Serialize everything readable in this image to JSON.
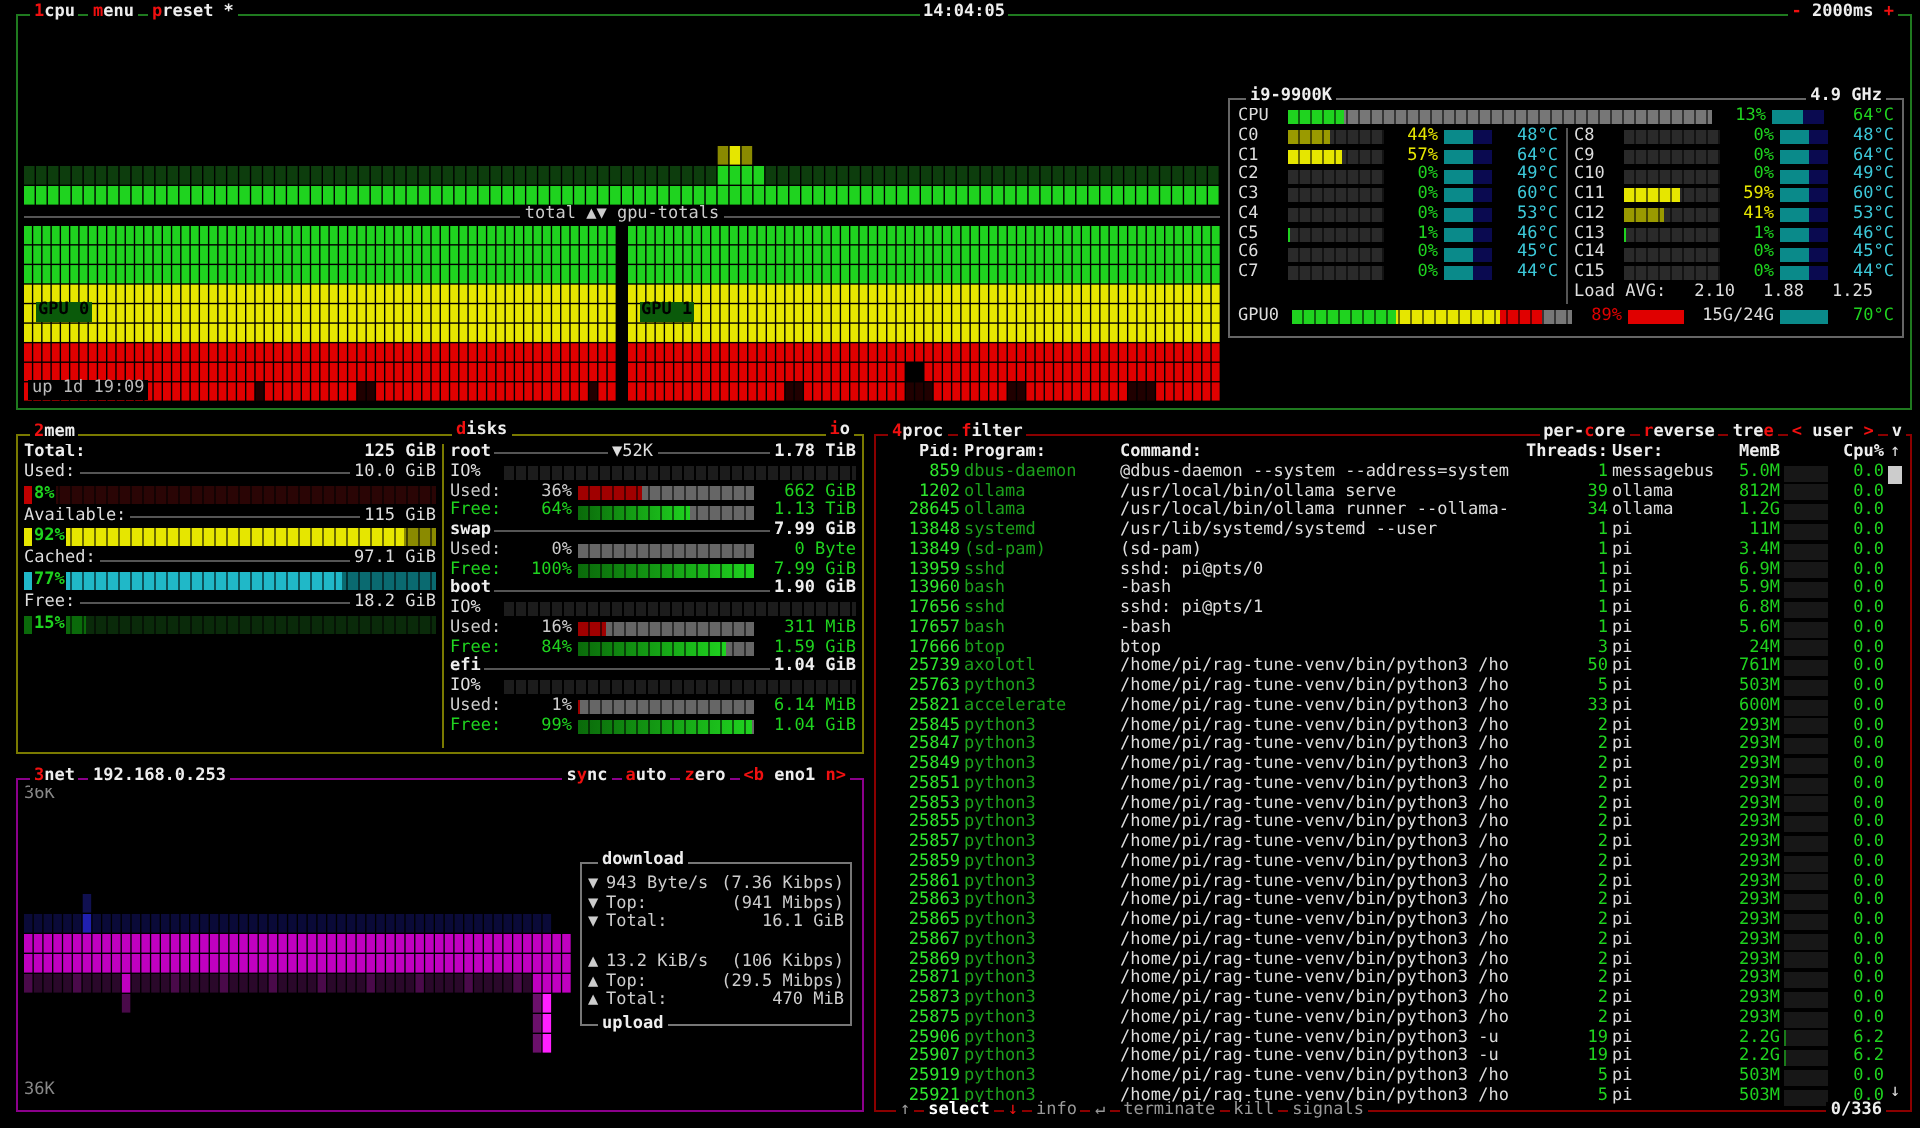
{
  "cpu": {
    "title_items": [
      {
        "key": "1",
        "post": "cpu"
      },
      {
        "key": "m",
        "post": "enu"
      },
      {
        "key": "p",
        "post": "reset *"
      }
    ],
    "clock": "14:04:05",
    "interval": {
      "minus": "-",
      "value": "2000ms",
      "plus": "+"
    },
    "graph_label": "total ▲▼ gpu-totals",
    "gpus": [
      {
        "label": "GPU 0"
      },
      {
        "label": "GPU 1"
      }
    ],
    "uptime": "up 1d 19:09",
    "info": {
      "model": "i9-9900K",
      "freq": "4.9 GHz",
      "total": {
        "label": "CPU",
        "level": 0.13,
        "percent": "13%",
        "temp": "64°C"
      },
      "cores": [
        {
          "name": "C0",
          "level": 0.44,
          "percent": "44%",
          "temp": "48°C"
        },
        {
          "name": "C1",
          "level": 0.57,
          "percent": "57%",
          "temp": "64°C"
        },
        {
          "name": "C2",
          "level": 0,
          "percent": "0%",
          "temp": "49°C"
        },
        {
          "name": "C3",
          "level": 0,
          "percent": "0%",
          "temp": "60°C"
        },
        {
          "name": "C4",
          "level": 0,
          "percent": "0%",
          "temp": "53°C"
        },
        {
          "name": "C5",
          "level": 0.01,
          "percent": "1%",
          "temp": "46°C"
        },
        {
          "name": "C6",
          "level": 0,
          "percent": "0%",
          "temp": "45°C"
        },
        {
          "name": "C7",
          "level": 0,
          "percent": "0%",
          "temp": "44°C"
        },
        {
          "name": "C8",
          "level": 0,
          "percent": "0%",
          "temp": "48°C"
        },
        {
          "name": "C9",
          "level": 0,
          "percent": "0%",
          "temp": "64°C"
        },
        {
          "name": "C10",
          "level": 0,
          "percent": "0%",
          "temp": "49°C"
        },
        {
          "name": "C11",
          "level": 0.59,
          "percent": "59%",
          "temp": "60°C"
        },
        {
          "name": "C12",
          "level": 0.41,
          "percent": "41%",
          "temp": "53°C"
        },
        {
          "name": "C13",
          "level": 0.01,
          "percent": "1%",
          "temp": "46°C"
        },
        {
          "name": "C14",
          "level": 0,
          "percent": "0%",
          "temp": "45°C"
        },
        {
          "name": "C15",
          "level": 0,
          "percent": "0%",
          "temp": "44°C"
        }
      ],
      "load_label": "Load AVG:",
      "load": [
        "2.10",
        "1.88",
        "1.25"
      ],
      "gpu": {
        "label": "GPU0",
        "level": 0.89,
        "percent": "89%",
        "mem": "15G/24G",
        "temp": "70°C"
      }
    }
  },
  "mem": {
    "title": {
      "key": "2",
      "post": "mem"
    },
    "total": {
      "label": "Total:",
      "value": "125 GiB"
    },
    "meters": [
      {
        "kind": "used",
        "label": "Used:",
        "value": "10.0 GiB",
        "percent": "8%",
        "level": 0.08
      },
      {
        "kind": "available",
        "label": "Available:",
        "value": "115 GiB",
        "percent": "92%",
        "level": 0.92
      },
      {
        "kind": "cached",
        "label": "Cached:",
        "value": "97.1 GiB",
        "percent": "77%",
        "level": 0.77
      },
      {
        "kind": "free",
        "label": "Free:",
        "value": "18.2 GiB",
        "percent": "15%",
        "level": 0.15
      }
    ]
  },
  "disks": {
    "title": {
      "key": "d",
      "post": "isks"
    },
    "io_toggle": {
      "key": "i",
      "post": "o"
    },
    "items": [
      {
        "name": "root",
        "io_rate": "▼52K",
        "total": "1.78 TiB",
        "io_label": "IO%",
        "used": {
          "label": "Used:",
          "percent": "36%",
          "level": 0.36,
          "value": "662 GiB"
        },
        "free": {
          "label": "Free:",
          "percent": "64%",
          "level": 0.64,
          "value": "1.13 TiB"
        }
      },
      {
        "name": "swap",
        "total": "7.99 GiB",
        "used": {
          "label": "Used:",
          "percent": "0%",
          "level": 0,
          "value": "0 Byte"
        },
        "free": {
          "label": "Free:",
          "percent": "100%",
          "level": 1,
          "value": "7.99 GiB"
        }
      },
      {
        "name": "boot",
        "total": "1.90 GiB",
        "io_label": "IO%",
        "used": {
          "label": "Used:",
          "percent": "16%",
          "level": 0.16,
          "value": "311 MiB"
        },
        "free": {
          "label": "Free:",
          "percent": "84%",
          "level": 0.84,
          "value": "1.59 GiB"
        }
      },
      {
        "name": "efi",
        "total": "1.04 GiB",
        "io_label": "IO%",
        "used": {
          "label": "Used:",
          "percent": "1%",
          "level": 0.01,
          "value": "6.14 MiB"
        },
        "free": {
          "label": "Free:",
          "percent": "99%",
          "level": 0.99,
          "value": "1.04 GiB"
        }
      }
    ]
  },
  "net": {
    "title": {
      "key": "3",
      "post": "net"
    },
    "address": "192.168.0.253",
    "options": [
      {
        "pre": "s",
        "key": "y",
        "post": "nc"
      },
      {
        "key": "a",
        "post": "uto"
      },
      {
        "key": "z",
        "post": "ero"
      }
    ],
    "interface": {
      "prev": "<b",
      "name": "eno1",
      "next": "n>"
    },
    "scale_top": "36K",
    "scale_bottom": "36K",
    "download": {
      "title": "download",
      "rows": [
        {
          "icon": "▼",
          "label": "943 Byte/s",
          "value": "(7.36 Kibps)"
        },
        {
          "icon": "▼",
          "label": "Top:",
          "value": "(941 Mibps)"
        },
        {
          "icon": "▼",
          "label": "Total:",
          "value": "16.1 GiB"
        }
      ]
    },
    "upload": {
      "title": "upload",
      "rows": [
        {
          "icon": "▲",
          "label": "13.2 KiB/s",
          "value": "(106 Kibps)"
        },
        {
          "icon": "▲",
          "label": "Top:",
          "value": "(29.5 Mibps)"
        },
        {
          "icon": "▲",
          "label": "Total:",
          "value": "470 MiB"
        }
      ]
    }
  },
  "proc": {
    "title": {
      "key": "4",
      "post": "proc"
    },
    "filter": {
      "key": "f",
      "post": "ilter"
    },
    "options": [
      {
        "pre": "per-",
        "key": "c",
        "post": "ore"
      },
      {
        "key": "r",
        "post": "everse"
      },
      {
        "pre": "tre",
        "key": "e"
      }
    ],
    "sort": {
      "prev": "<",
      "label": "user",
      "next": ">"
    },
    "cut_option": "v",
    "columns": [
      "Pid:",
      "Program:",
      "Command:",
      "Threads:",
      "User:",
      "MemB",
      "Cpu%"
    ],
    "scroll_up": "↑",
    "scroll_down": "↓",
    "rows": [
      {
        "pid": "859",
        "program": "dbus-daemon",
        "command": "@dbus-daemon --system --address=system",
        "threads": "1",
        "user": "messagebus",
        "mem": "5.0M",
        "level": 0,
        "cpu": "0.0"
      },
      {
        "pid": "1202",
        "program": "ollama",
        "command": "/usr/local/bin/ollama serve",
        "threads": "39",
        "user": "ollama",
        "mem": "812M",
        "level": 0,
        "cpu": "0.0"
      },
      {
        "pid": "28645",
        "program": "ollama",
        "command": "/usr/local/bin/ollama runner --ollama-",
        "threads": "34",
        "user": "ollama",
        "mem": "1.2G",
        "level": 0,
        "cpu": "0.0"
      },
      {
        "pid": "13848",
        "program": "systemd",
        "command": "/usr/lib/systemd/systemd --user",
        "threads": "1",
        "user": "pi",
        "mem": "11M",
        "level": 0,
        "cpu": "0.0"
      },
      {
        "pid": "13849",
        "program": "(sd-pam)",
        "command": "(sd-pam)",
        "threads": "1",
        "user": "pi",
        "mem": "3.4M",
        "level": 0,
        "cpu": "0.0"
      },
      {
        "pid": "13959",
        "program": "sshd",
        "command": "sshd: pi@pts/0",
        "threads": "1",
        "user": "pi",
        "mem": "6.9M",
        "level": 0,
        "cpu": "0.0"
      },
      {
        "pid": "13960",
        "program": "bash",
        "command": "-bash",
        "threads": "1",
        "user": "pi",
        "mem": "5.9M",
        "level": 0,
        "cpu": "0.0"
      },
      {
        "pid": "17656",
        "program": "sshd",
        "command": "sshd: pi@pts/1",
        "threads": "1",
        "user": "pi",
        "mem": "6.8M",
        "level": 0,
        "cpu": "0.0"
      },
      {
        "pid": "17657",
        "program": "bash",
        "command": "-bash",
        "threads": "1",
        "user": "pi",
        "mem": "5.6M",
        "level": 0,
        "cpu": "0.0"
      },
      {
        "pid": "17666",
        "program": "btop",
        "command": "btop",
        "threads": "3",
        "user": "pi",
        "mem": "24M",
        "level": 0,
        "cpu": "0.0"
      },
      {
        "pid": "25739",
        "program": "axolotl",
        "command": "/home/pi/rag-tune-venv/bin/python3 /ho",
        "threads": "50",
        "user": "pi",
        "mem": "761M",
        "level": 0,
        "cpu": "0.0"
      },
      {
        "pid": "25763",
        "program": "python3",
        "command": "/home/pi/rag-tune-venv/bin/python3 /ho",
        "threads": "5",
        "user": "pi",
        "mem": "503M",
        "level": 0,
        "cpu": "0.0"
      },
      {
        "pid": "25821",
        "program": "accelerate",
        "command": "/home/pi/rag-tune-venv/bin/python3 /ho",
        "threads": "33",
        "user": "pi",
        "mem": "600M",
        "level": 0,
        "cpu": "0.0"
      },
      {
        "pid": "25845",
        "program": "python3",
        "command": "/home/pi/rag-tune-venv/bin/python3 /ho",
        "threads": "2",
        "user": "pi",
        "mem": "293M",
        "level": 0,
        "cpu": "0.0"
      },
      {
        "pid": "25847",
        "program": "python3",
        "command": "/home/pi/rag-tune-venv/bin/python3 /ho",
        "threads": "2",
        "user": "pi",
        "mem": "293M",
        "level": 0,
        "cpu": "0.0"
      },
      {
        "pid": "25849",
        "program": "python3",
        "command": "/home/pi/rag-tune-venv/bin/python3 /ho",
        "threads": "2",
        "user": "pi",
        "mem": "293M",
        "level": 0,
        "cpu": "0.0"
      },
      {
        "pid": "25851",
        "program": "python3",
        "command": "/home/pi/rag-tune-venv/bin/python3 /ho",
        "threads": "2",
        "user": "pi",
        "mem": "293M",
        "level": 0,
        "cpu": "0.0"
      },
      {
        "pid": "25853",
        "program": "python3",
        "command": "/home/pi/rag-tune-venv/bin/python3 /ho",
        "threads": "2",
        "user": "pi",
        "mem": "293M",
        "level": 0,
        "cpu": "0.0"
      },
      {
        "pid": "25855",
        "program": "python3",
        "command": "/home/pi/rag-tune-venv/bin/python3 /ho",
        "threads": "2",
        "user": "pi",
        "mem": "293M",
        "level": 0,
        "cpu": "0.0"
      },
      {
        "pid": "25857",
        "program": "python3",
        "command": "/home/pi/rag-tune-venv/bin/python3 /ho",
        "threads": "2",
        "user": "pi",
        "mem": "293M",
        "level": 0,
        "cpu": "0.0"
      },
      {
        "pid": "25859",
        "program": "python3",
        "command": "/home/pi/rag-tune-venv/bin/python3 /ho",
        "threads": "2",
        "user": "pi",
        "mem": "293M",
        "level": 0,
        "cpu": "0.0"
      },
      {
        "pid": "25861",
        "program": "python3",
        "command": "/home/pi/rag-tune-venv/bin/python3 /ho",
        "threads": "2",
        "user": "pi",
        "mem": "293M",
        "level": 0,
        "cpu": "0.0"
      },
      {
        "pid": "25863",
        "program": "python3",
        "command": "/home/pi/rag-tune-venv/bin/python3 /ho",
        "threads": "2",
        "user": "pi",
        "mem": "293M",
        "level": 0,
        "cpu": "0.0"
      },
      {
        "pid": "25865",
        "program": "python3",
        "command": "/home/pi/rag-tune-venv/bin/python3 /ho",
        "threads": "2",
        "user": "pi",
        "mem": "293M",
        "level": 0,
        "cpu": "0.0"
      },
      {
        "pid": "25867",
        "program": "python3",
        "command": "/home/pi/rag-tune-venv/bin/python3 /ho",
        "threads": "2",
        "user": "pi",
        "mem": "293M",
        "level": 0,
        "cpu": "0.0"
      },
      {
        "pid": "25869",
        "program": "python3",
        "command": "/home/pi/rag-tune-venv/bin/python3 /ho",
        "threads": "2",
        "user": "pi",
        "mem": "293M",
        "level": 0,
        "cpu": "0.0"
      },
      {
        "pid": "25871",
        "program": "python3",
        "command": "/home/pi/rag-tune-venv/bin/python3 /ho",
        "threads": "2",
        "user": "pi",
        "mem": "293M",
        "level": 0,
        "cpu": "0.0"
      },
      {
        "pid": "25873",
        "program": "python3",
        "command": "/home/pi/rag-tune-venv/bin/python3 /ho",
        "threads": "2",
        "user": "pi",
        "mem": "293M",
        "level": 0,
        "cpu": "0.0"
      },
      {
        "pid": "25875",
        "program": "python3",
        "command": "/home/pi/rag-tune-venv/bin/python3 /ho",
        "threads": "2",
        "user": "pi",
        "mem": "293M",
        "level": 0,
        "cpu": "0.0"
      },
      {
        "pid": "25906",
        "program": "python3",
        "command": "/home/pi/rag-tune-venv/bin/python3 -u",
        "threads": "19",
        "user": "pi",
        "mem": "2.2G",
        "level": 0.062,
        "cpu": "6.2"
      },
      {
        "pid": "25907",
        "program": "python3",
        "command": "/home/pi/rag-tune-venv/bin/python3 -u",
        "threads": "19",
        "user": "pi",
        "mem": "2.2G",
        "level": 0.062,
        "cpu": "6.2"
      },
      {
        "pid": "25919",
        "program": "python3",
        "command": "/home/pi/rag-tune-venv/bin/python3 /ho",
        "threads": "5",
        "user": "pi",
        "mem": "503M",
        "level": 0,
        "cpu": "0.0"
      },
      {
        "pid": "25921",
        "program": "python3",
        "command": "/home/pi/rag-tune-venv/bin/python3 /ho",
        "threads": "5",
        "user": "pi",
        "mem": "503M",
        "level": 0,
        "cpu": "0.0"
      }
    ],
    "footer": {
      "up": "↑",
      "select": "select",
      "down": "↓",
      "actions": [
        {
          "label": "info"
        },
        {
          "icon": "↵",
          "label": "terminate"
        },
        {
          "label": "kill"
        },
        {
          "label": "signals"
        }
      ],
      "count": "0/336"
    }
  }
}
